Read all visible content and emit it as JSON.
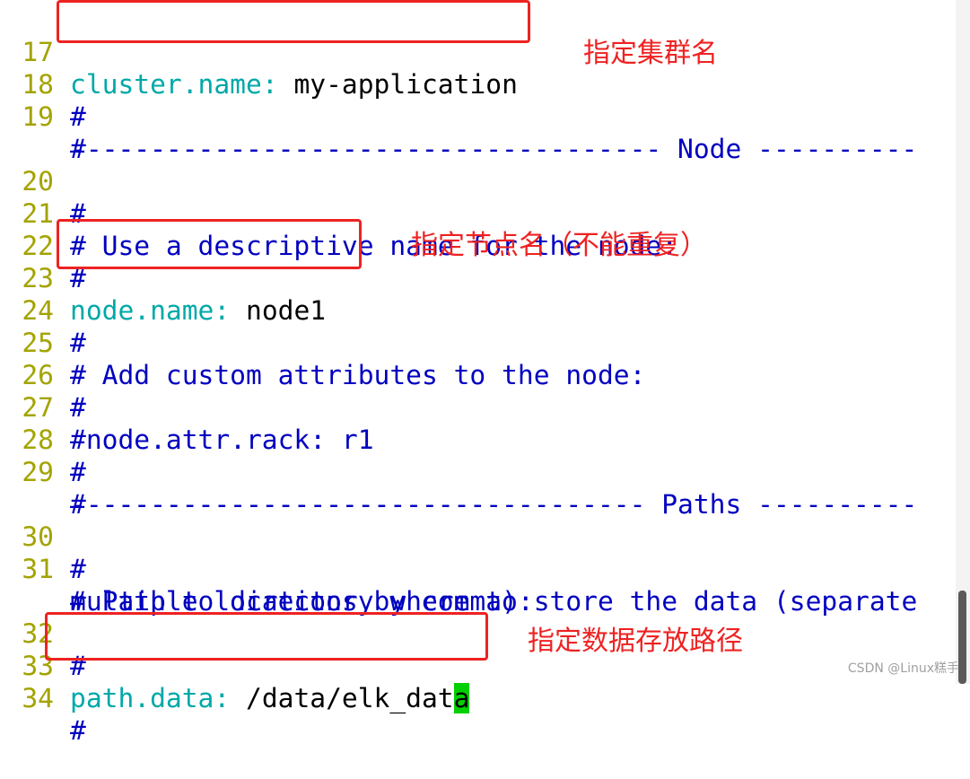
{
  "editor": {
    "lines": [
      {
        "num": "17",
        "key": "cluster.name",
        "colon": ":",
        "value": " my-application"
      },
      {
        "num": "18",
        "comment": "#"
      },
      {
        "num": "19",
        "comment": "# ----------------------------------- Node ----------",
        "cont": "--------------------------"
      },
      {
        "num": "20",
        "comment": "#"
      },
      {
        "num": "21",
        "comment": "# Use a descriptive name for the node:"
      },
      {
        "num": "22",
        "comment": "#"
      },
      {
        "num": "23",
        "key": "node.name",
        "colon": ":",
        "value": " node1"
      },
      {
        "num": "24",
        "comment": "#"
      },
      {
        "num": "25",
        "comment": "# Add custom attributes to the node:"
      },
      {
        "num": "26",
        "comment": "#"
      },
      {
        "num": "27",
        "comment": "#node.attr.rack: r1"
      },
      {
        "num": "28",
        "comment": "#"
      },
      {
        "num": "29",
        "comment": "# ---------------------------------- Paths ----------",
        "cont": "--------------------------"
      },
      {
        "num": "30",
        "comment": "#"
      },
      {
        "num": "31",
        "comment": "# Path to directory where to store the data (separate",
        "cont": "multiple locations by comma):"
      },
      {
        "num": "32",
        "comment": "#"
      },
      {
        "num": "33",
        "key": "path.data",
        "colon": ":",
        "value": " /data/elk_dat",
        "cursor_char": "a"
      },
      {
        "num": "34",
        "comment": "#"
      }
    ]
  },
  "annotations": {
    "cluster_name": "指定集群名",
    "node_name": "指定节点名（不能重复）",
    "path_data": "指定数据存放路径"
  },
  "watermark": "CSDN @Linux糕手",
  "colors": {
    "line_number": "#a3a300",
    "comment": "#0000c0",
    "key": "#00a8a8",
    "annotation": "#ee2222",
    "cursor": "#00d000"
  }
}
